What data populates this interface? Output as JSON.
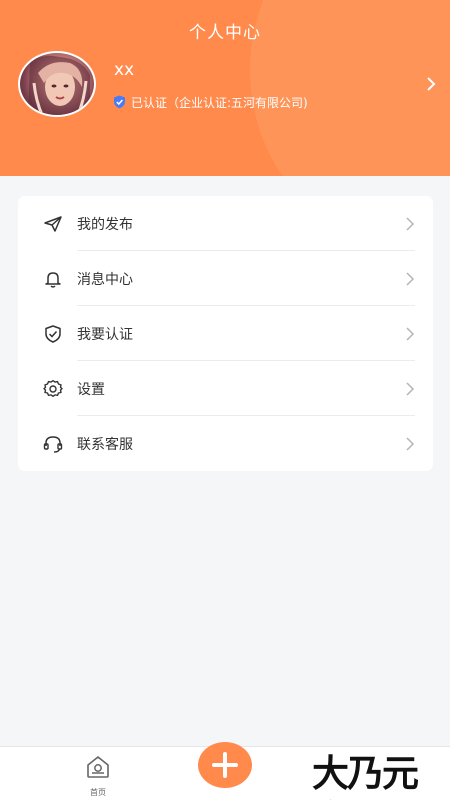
{
  "header": {
    "title": "个人中心",
    "user_name": "xx",
    "verify_text": "已认证（企业认证:五河有限公司)",
    "background_color": "#ff8a4c"
  },
  "menu": {
    "items": [
      {
        "label": "我的发布",
        "icon": "paper-plane-icon"
      },
      {
        "label": "消息中心",
        "icon": "bell-icon"
      },
      {
        "label": "我要认证",
        "icon": "shield-check-icon"
      },
      {
        "label": "设置",
        "icon": "gear-icon"
      },
      {
        "label": "联系客服",
        "icon": "headset-icon"
      }
    ]
  },
  "tabbar": {
    "home_label": "首页",
    "fab_icon": "plus-icon",
    "accent_color": "#ff8a4c"
  },
  "watermark": {
    "text": "大乃元客"
  }
}
